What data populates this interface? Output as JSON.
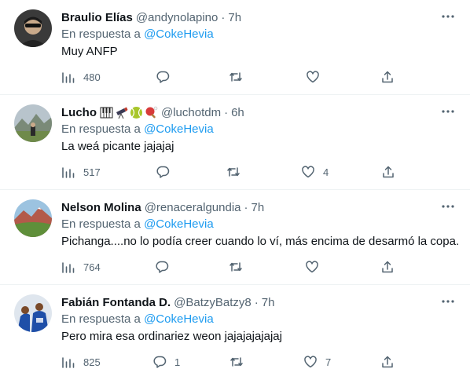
{
  "reply_prefix": "En respuesta a",
  "tweets": [
    {
      "name": "Braulio Elías",
      "handle": "@andynolapino",
      "separator": "·",
      "time": "7h",
      "reply_to": "@CokeHevia",
      "text": "Muy ANFP",
      "views": "480",
      "replies": "",
      "retweets": "",
      "likes": ""
    },
    {
      "name": "Lucho",
      "handle": "@luchotdm",
      "separator": "·",
      "time": "6h",
      "emojis": [
        "piano-emoji",
        "telescope-emoji",
        "tennis-ball-emoji",
        "ping-pong-emoji"
      ],
      "reply_to": "@CokeHevia",
      "text": "La weá picante jajajaj",
      "views": "517",
      "replies": "",
      "retweets": "",
      "likes": "4"
    },
    {
      "name": "Nelson Molina",
      "handle": "@renaceralgundia",
      "separator": "·",
      "time": "7h",
      "reply_to": "@CokeHevia",
      "text": "Pichanga....no lo podía creer cuando lo ví, más encima de desarmó la copa.",
      "views": "764",
      "replies": "",
      "retweets": "",
      "likes": ""
    },
    {
      "name": "Fabián Fontanda D.",
      "handle": "@BatzyBatzy8",
      "separator": "·",
      "time": "7h",
      "reply_to": "@CokeHevia",
      "text": "Pero mira esa ordinariez weon jajajajajajaj",
      "views": "825",
      "replies": "1",
      "retweets": "",
      "likes": "7"
    }
  ],
  "colors": {
    "text_primary": "#0f1419",
    "text_secondary": "#536471",
    "mention": "#1d9bf0",
    "divider": "#eff3f4"
  },
  "icons": {
    "views": "bar-chart-icon",
    "reply": "reply-bubble-icon",
    "retweet": "retweet-icon",
    "like": "heart-icon",
    "share": "share-icon",
    "more": "more-options-icon"
  }
}
